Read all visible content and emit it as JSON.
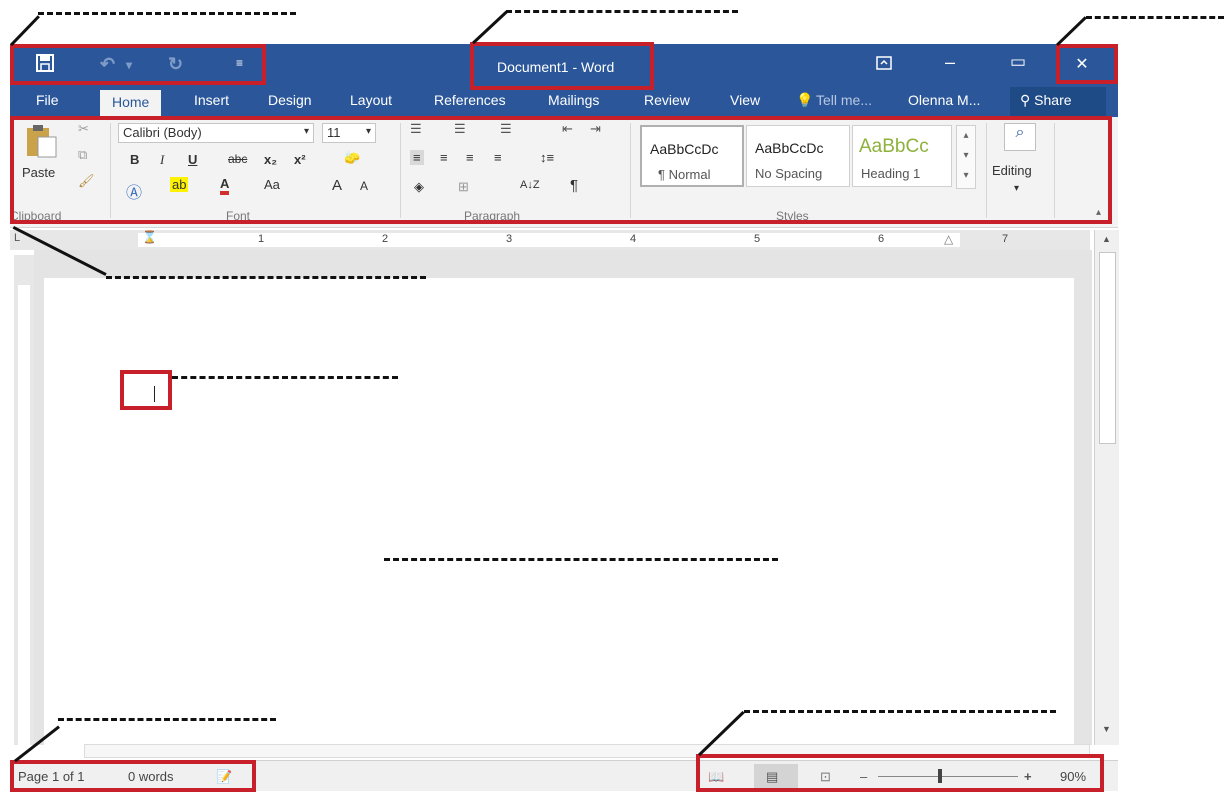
{
  "titlebar": {
    "doc_title": "Document1 - Word",
    "save_icon": "save-icon",
    "undo_icon": "undo-icon",
    "redo_icon": "redo-icon",
    "customize_icon": "customize-qat-icon",
    "ribbon_display_icon": "ribbon-display-options-icon",
    "minimize_glyph": "–",
    "restore_glyph": "▭",
    "close_glyph": "✕"
  },
  "tabs": [
    {
      "label": "File"
    },
    {
      "label": "Home"
    },
    {
      "label": "Insert"
    },
    {
      "label": "Design"
    },
    {
      "label": "Layout"
    },
    {
      "label": "References"
    },
    {
      "label": "Mailings"
    },
    {
      "label": "Review"
    },
    {
      "label": "View"
    },
    {
      "label": "Tell me..."
    }
  ],
  "user": {
    "name": "Olenna M...",
    "share_label": "Share"
  },
  "ribbon": {
    "clipboard": {
      "paste_label": "Paste",
      "group_label": "Clipboard"
    },
    "font": {
      "font_name": "Calibri (Body)",
      "font_size": "11",
      "group_label": "Font",
      "bold": "B",
      "italic": "I",
      "underline": "U",
      "strike": "abc",
      "subscript": "x₂",
      "superscript": "x²",
      "change_case": "Aa",
      "grow": "A",
      "shrink": "A",
      "font_color": "A"
    },
    "paragraph": {
      "group_label": "Paragraph",
      "sort": "A↓Z",
      "pilcrow": "¶"
    },
    "styles": {
      "group_label": "Styles",
      "items": [
        {
          "preview": "AaBbCcDc",
          "name": "¶ Normal"
        },
        {
          "preview": "AaBbCcDc",
          "name": "No Spacing"
        },
        {
          "preview": "AaBbCc",
          "name": "Heading 1"
        }
      ]
    },
    "editing": {
      "label": "Editing"
    }
  },
  "ruler": {
    "numbers": [
      "1",
      "2",
      "3",
      "4",
      "5",
      "6",
      "7"
    ]
  },
  "status": {
    "page": "Page 1 of 1",
    "words": "0 words",
    "zoom": "90%",
    "zoom_level": 0.9
  },
  "colors": {
    "accent": "#2b579a",
    "annotation": "#c8202b",
    "heading": "#8db13a"
  }
}
